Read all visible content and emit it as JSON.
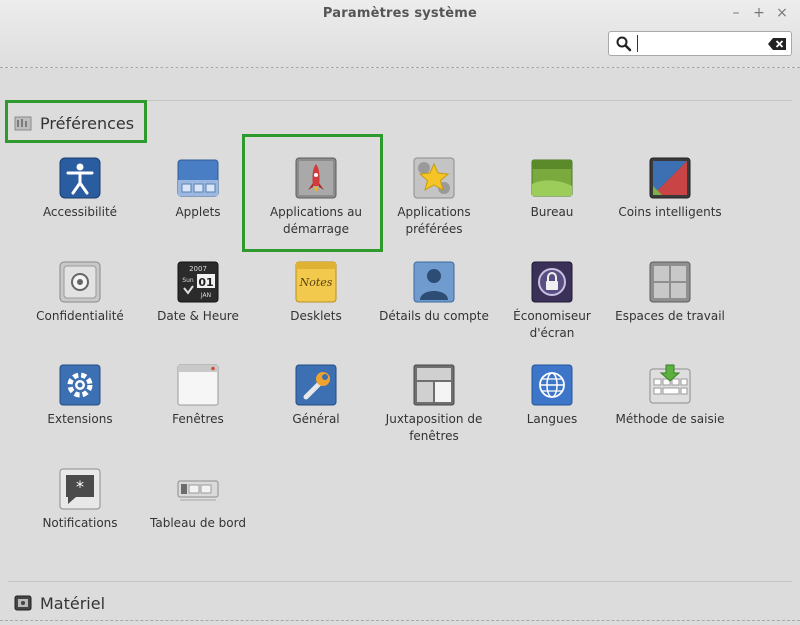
{
  "window": {
    "title": "Paramètres système"
  },
  "search": {
    "placeholder": "",
    "value": ""
  },
  "sections": {
    "preferences": "Préférences",
    "hardware": "Matériel"
  },
  "items": [
    {
      "label": "Accessibilité",
      "icon": "accessibility-icon"
    },
    {
      "label": "Applets",
      "icon": "applets-icon"
    },
    {
      "label": "Applications au démarrage",
      "icon": "startup-applications-icon"
    },
    {
      "label": "Applications préférées",
      "icon": "preferred-applications-icon"
    },
    {
      "label": "Bureau",
      "icon": "desktop-icon"
    },
    {
      "label": "Coins intelligents",
      "icon": "hot-corners-icon"
    },
    {
      "label": "Confidentialité",
      "icon": "privacy-icon"
    },
    {
      "label": "Date & Heure",
      "icon": "date-time-icon"
    },
    {
      "label": "Desklets",
      "icon": "desklets-icon"
    },
    {
      "label": "Détails du compte",
      "icon": "account-details-icon"
    },
    {
      "label": "Économiseur d'écran",
      "icon": "screensaver-icon"
    },
    {
      "label": "Espaces de travail",
      "icon": "workspaces-icon"
    },
    {
      "label": "Extensions",
      "icon": "extensions-icon"
    },
    {
      "label": "Fenêtres",
      "icon": "windows-icon"
    },
    {
      "label": "Général",
      "icon": "general-icon"
    },
    {
      "label": "Juxtaposition de fenêtres",
      "icon": "window-tiling-icon"
    },
    {
      "label": "Langues",
      "icon": "languages-icon"
    },
    {
      "label": "Méthode de saisie",
      "icon": "input-method-icon"
    },
    {
      "label": "Notifications",
      "icon": "notifications-icon"
    },
    {
      "label": "Tableau de bord",
      "icon": "panel-icon"
    }
  ],
  "date_icon": {
    "year": "2007",
    "weekday": "Sun",
    "day": "01",
    "month": "JAN"
  },
  "desklets_icon": {
    "text": "Notes"
  },
  "colors": {
    "highlight": "#2e9a2e"
  }
}
